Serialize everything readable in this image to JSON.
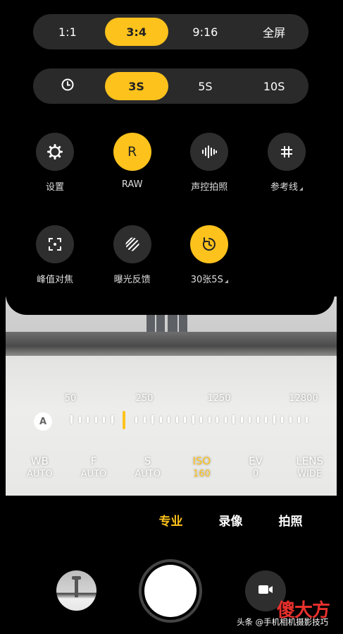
{
  "aspect_ratio": {
    "options": [
      "1:1",
      "3:4",
      "9:16",
      "全屏"
    ],
    "selected": "3:4"
  },
  "timer": {
    "icon": "clock-icon",
    "options": [
      "3S",
      "5S",
      "10S"
    ],
    "selected": "3S"
  },
  "tools_row1": [
    {
      "label": "设置",
      "icon": "gear-icon",
      "active": false
    },
    {
      "label": "RAW",
      "icon_text": "R",
      "active": true
    },
    {
      "label": "声控拍照",
      "icon": "sound-wave-icon",
      "active": false
    },
    {
      "label": "参考线",
      "icon": "grid-icon",
      "active": false,
      "has_submenu": true
    }
  ],
  "tools_row2": [
    {
      "label": "峰值对焦",
      "icon": "focus-frame-icon",
      "active": false
    },
    {
      "label": "曝光反馈",
      "icon": "stripes-icon",
      "active": false
    },
    {
      "label": "30张5S",
      "icon": "burst-timer-icon",
      "active": true,
      "has_submenu": true
    }
  ],
  "iso_slider": {
    "auto_label": "A",
    "scale_labels": [
      "50",
      "250",
      "1250",
      "12800"
    ],
    "current_value": 160
  },
  "params": [
    {
      "key": "WB",
      "value": "AUTO",
      "active": false
    },
    {
      "key": "F",
      "value": "AUTO",
      "active": false
    },
    {
      "key": "S",
      "value": "AUTO",
      "active": false
    },
    {
      "key": "ISO",
      "value": "160",
      "active": true
    },
    {
      "key": "EV",
      "value": "0",
      "active": false
    },
    {
      "key": "LENS",
      "value": "WIDE",
      "active": false
    }
  ],
  "modes": [
    {
      "label": "专业",
      "active": true
    },
    {
      "label": "录像",
      "active": false
    },
    {
      "label": "拍照",
      "active": false
    }
  ],
  "watermark": {
    "logo": "傻大方",
    "text": "头条 @手机相机摄影技巧"
  },
  "colors": {
    "accent": "#fdc21c",
    "panel_bg": "#000000",
    "button_bg": "#2e2e2e"
  }
}
